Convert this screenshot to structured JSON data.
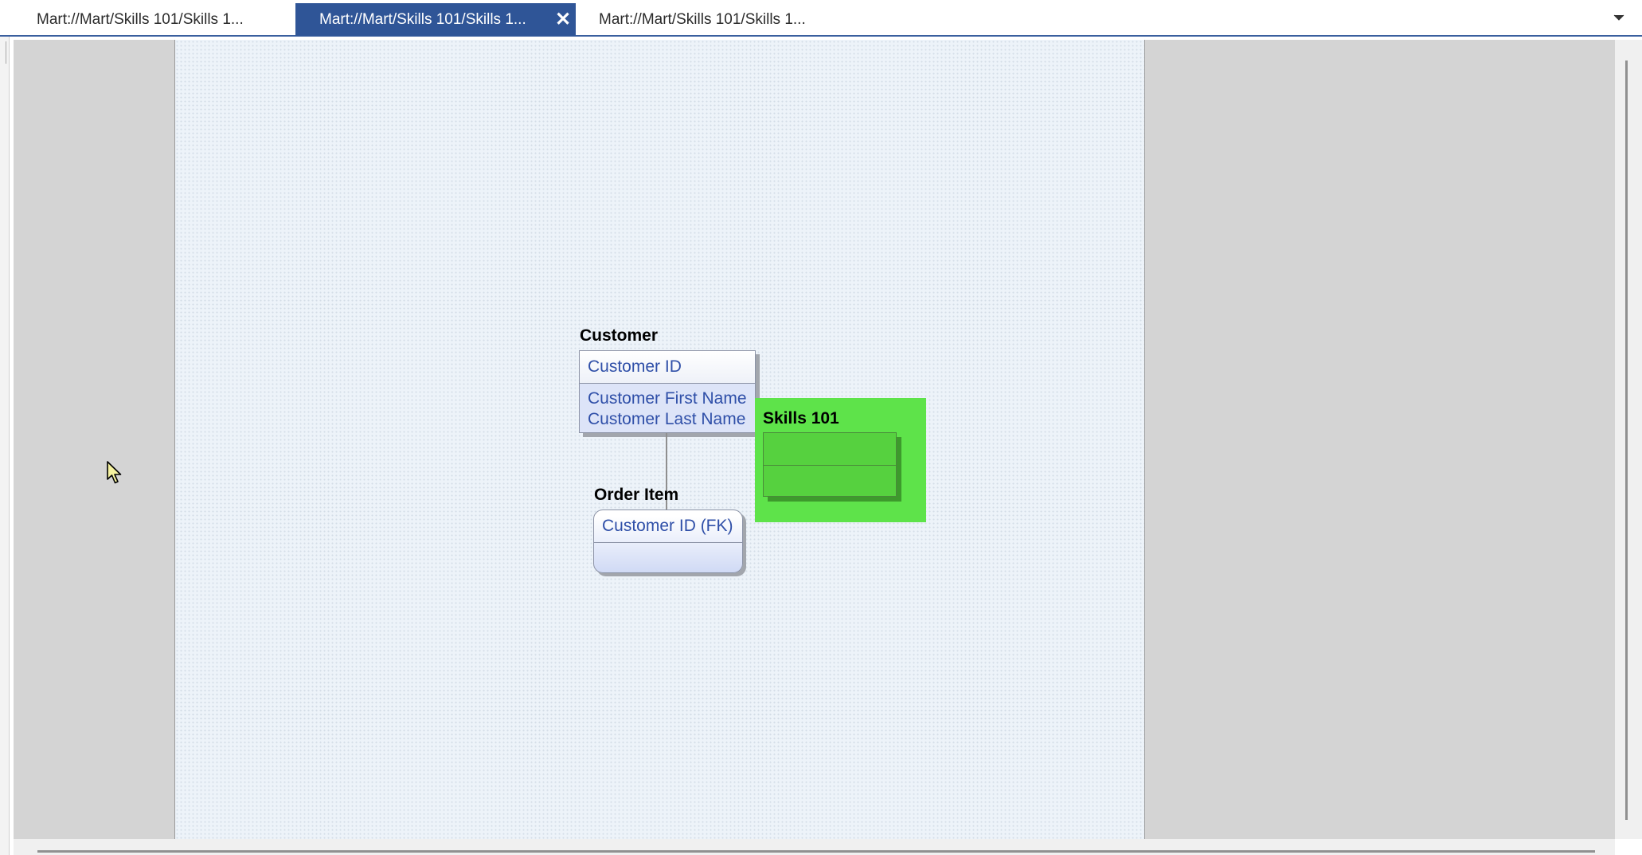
{
  "tabs": [
    {
      "label": "Mart://Mart/Skills 101/Skills 1...",
      "active": false
    },
    {
      "label": "Mart://Mart/Skills 101/Skills 1...",
      "active": true
    },
    {
      "label": "Mart://Mart/Skills 101/Skills 1...",
      "active": false
    }
  ],
  "tab_close_glyph": "✕",
  "diagram": {
    "customer": {
      "title": "Customer",
      "key_attributes": [
        "Customer ID"
      ],
      "non_key_attributes": [
        "Customer First Name",
        "Customer Last Name"
      ]
    },
    "order_item": {
      "title": "Order Item",
      "key_attributes": [
        "Customer ID  (FK)"
      ],
      "non_key_attributes": []
    },
    "subject_area": {
      "title": "Skills 101",
      "color": "#5ee34a"
    }
  },
  "colors": {
    "active_tab": "#2f5597",
    "page_background": "#edf3f9",
    "attribute_text": "#2f4fa8"
  }
}
